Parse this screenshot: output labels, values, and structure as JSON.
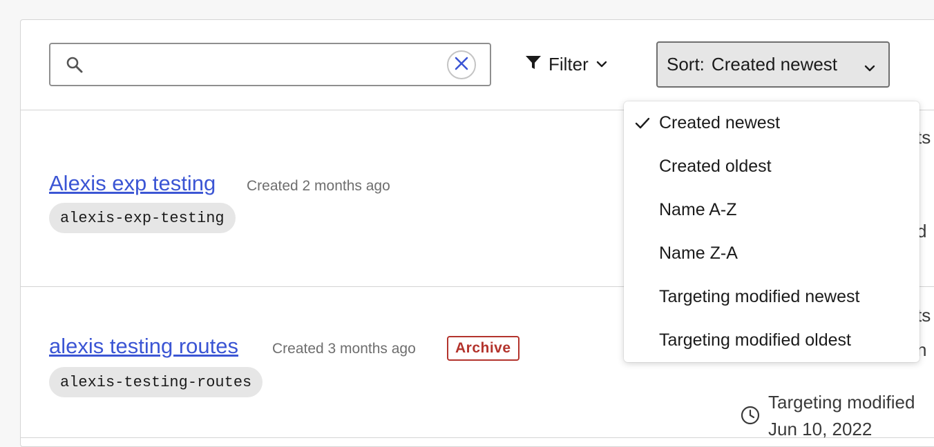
{
  "toolbar": {
    "search": {
      "value": "",
      "placeholder": ""
    },
    "filter_label": "Filter",
    "sort_prefix": "Sort:",
    "sort_value": "Created newest"
  },
  "sort_menu": {
    "selected_index": 0,
    "options": [
      "Created newest",
      "Created oldest",
      "Name A-Z",
      "Name Z-A",
      "Targeting modified newest",
      "Targeting modified oldest"
    ]
  },
  "flags": [
    {
      "name": "Alexis exp testing",
      "created": "Created 2 months ago",
      "key": "alexis-exp-testing",
      "side_fragments": [
        "ts",
        "d"
      ]
    },
    {
      "name": "alexis testing routes",
      "created": "Created 3 months ago",
      "badge": "Archive",
      "key": "alexis-testing-routes",
      "side_fragments": [
        "ts",
        "n"
      ],
      "targeting_label": "Targeting modified",
      "targeting_date": "Jun 10, 2022"
    }
  ],
  "colors": {
    "link": "#3b55d4",
    "archive": "#b3332c",
    "pill_bg": "#e6e6e6"
  }
}
